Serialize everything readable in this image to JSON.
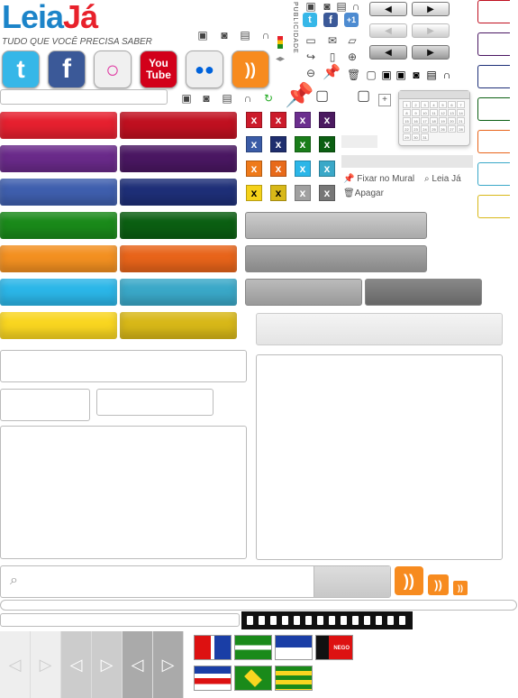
{
  "brand": {
    "name_part1": "Leia",
    "name_part2": "Já",
    "tagline": "TUDO QUE VOCÊ PRECISA SABER"
  },
  "social": [
    {
      "name": "twitter",
      "glyph": "t",
      "color": "#36b7e8"
    },
    {
      "name": "facebook",
      "glyph": "f",
      "color": "#3b5998"
    },
    {
      "name": "orkut",
      "glyph": "○",
      "color": "#e03ea4"
    },
    {
      "name": "youtube",
      "glyph": "You Tube",
      "color": "#d2001a"
    },
    {
      "name": "flickr",
      "glyph": "●●",
      "color": "#444"
    },
    {
      "name": "rss",
      "glyph": "))",
      "color": "#f78b1f"
    }
  ],
  "vertical_label": "PUBLICIDADE",
  "actions": {
    "pin": "Fixar no Mural",
    "search": "Leia Já",
    "delete": "Apagar"
  },
  "colors": {
    "red": [
      "#e6202f",
      "#c01020"
    ],
    "purple": [
      "#6a2a8a",
      "#4a1762"
    ],
    "blue": [
      "#3f5fae",
      "#1e2f78"
    ],
    "green": [
      "#1a8a1a",
      "#0b5f12"
    ],
    "orange": [
      "#f39021",
      "#e8641a"
    ],
    "cyan": [
      "#2bb6e8",
      "#3aa8c8"
    ],
    "yellow": [
      "#f9d620",
      "#d8b818"
    ]
  },
  "close_buttons": [
    [
      "#cc1b2b",
      "#cc1b2b",
      "#6b2e8e",
      "#4b1a60"
    ],
    [
      "#3a5ba6",
      "#1f2e6e",
      "#1a7d1a",
      "#0b5f12"
    ],
    [
      "#ef7a1a",
      "#e86a1a",
      "#2bb6e8",
      "#3aa8c8"
    ],
    [
      "#f5d21a",
      "#d8b818",
      "#a0a0a0",
      "#777777"
    ]
  ],
  "close_glyph": "x",
  "tab_colors": [
    "#c01020",
    "#4a1762",
    "#1e2f78",
    "#0b5f12",
    "#e8641a",
    "#3aa8c8",
    "#d8b818"
  ],
  "calendar": {
    "days": [
      "1",
      "2",
      "3",
      "4",
      "5",
      "6",
      "7",
      "8",
      "9",
      "10",
      "11",
      "12",
      "13",
      "14",
      "15",
      "16",
      "17",
      "18",
      "19",
      "20",
      "21",
      "22",
      "23",
      "24",
      "25",
      "26",
      "27",
      "28",
      "29",
      "30",
      "31"
    ]
  },
  "search": {
    "placeholder": ""
  },
  "flags_label": "NEGO",
  "nav_arrow_left": "◁",
  "nav_arrow_right": "▷",
  "arrow_left": "◀",
  "arrow_right": "▶"
}
